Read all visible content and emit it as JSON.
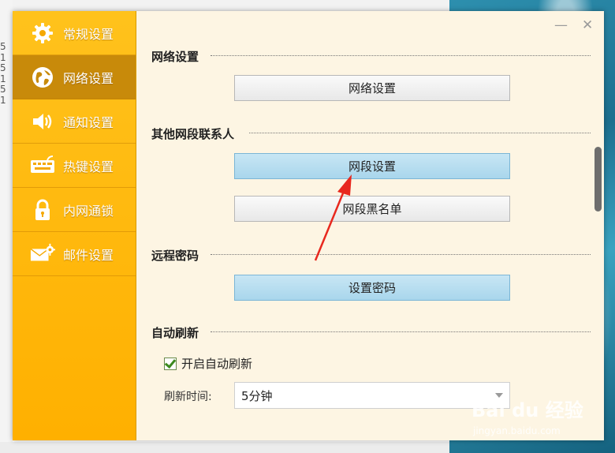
{
  "background": {
    "left_numbers": [
      "5 1",
      "5 1",
      "5 1"
    ]
  },
  "window": {
    "minimize_symbol": "—",
    "close_symbol": "✕"
  },
  "sidebar": {
    "items": [
      {
        "label": "常规设置",
        "icon": "gear-icon",
        "active": false
      },
      {
        "label": "网络设置",
        "icon": "globe-icon",
        "active": true
      },
      {
        "label": "通知设置",
        "icon": "speaker-icon",
        "active": false
      },
      {
        "label": "热键设置",
        "icon": "keyboard-icon",
        "active": false
      },
      {
        "label": "内网通锁",
        "icon": "lock-icon",
        "active": false
      },
      {
        "label": "邮件设置",
        "icon": "mail-settings-icon",
        "active": false
      }
    ]
  },
  "sections": {
    "network": {
      "title": "网络设置",
      "button": "网络设置"
    },
    "segment": {
      "title": "其他网段联系人",
      "button_primary": "网段设置",
      "button_secondary": "网段黑名单"
    },
    "password": {
      "title": "远程密码",
      "button": "设置密码"
    },
    "refresh": {
      "title": "自动刷新",
      "checkbox_label": "开启自动刷新",
      "checkbox_checked": true,
      "interval_label": "刷新时间:",
      "interval_value": "5分钟"
    }
  },
  "colors": {
    "sidebar": "#ffb800",
    "active_nav": "#c88a0a",
    "highlight_button": "#a9d6ec",
    "annotation_arrow": "#e8281e"
  },
  "watermark": {
    "brand": "Bai du 经验",
    "url": "jingyan.baidu.com"
  }
}
